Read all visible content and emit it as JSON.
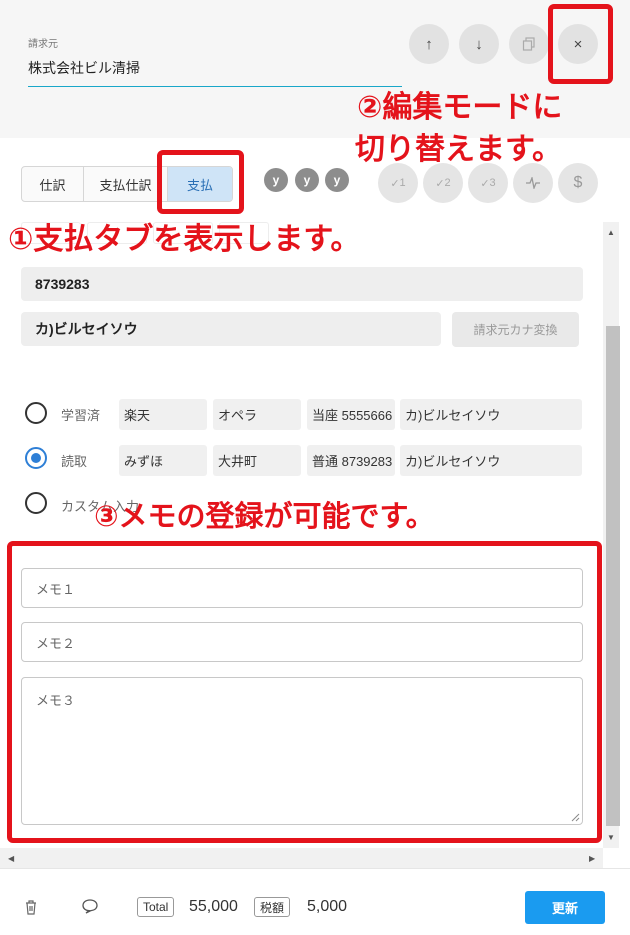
{
  "header": {
    "vendor_label": "請求元",
    "vendor_name": "株式会社ビル清掃",
    "buttons": {
      "up": "↑",
      "down": "↓",
      "close": "×"
    }
  },
  "tabs": [
    {
      "label": "仕訳"
    },
    {
      "label": "支払仕訳"
    },
    {
      "label": "支払"
    }
  ],
  "badges": [
    "y",
    "y",
    "y"
  ],
  "checks": [
    {
      "label": "1"
    },
    {
      "label": "2"
    },
    {
      "label": "3"
    }
  ],
  "dollar": "$",
  "payment": {
    "account_number": "8739283",
    "account_name_kana": "カ)ビルセイソウ",
    "kana_convert_button": "請求元カナ変換"
  },
  "radio_rows": [
    {
      "label": "学習済",
      "checked": false,
      "bank": "楽天",
      "branch": "オペラ",
      "account": "当座 5555666",
      "holder": "カ)ビルセイソウ"
    },
    {
      "label": "読取",
      "checked": true,
      "bank": "みずほ",
      "branch": "大井町",
      "account": "普通 8739283",
      "holder": "カ)ビルセイソウ"
    },
    {
      "label": "カスタム入力",
      "checked": false
    }
  ],
  "memos": {
    "memo1": "メモ１",
    "memo2": "メモ２",
    "memo3": "メモ３"
  },
  "footer": {
    "total_label": "Total",
    "total_value": "55,000",
    "tax_label": "税額",
    "tax_value": "5,000",
    "update_button": "更新"
  },
  "annotations": {
    "step1": "①支払タブを表示します。",
    "step2_line1": "②編集モードに",
    "step2_line2": "切り替えます。",
    "step3": "③メモの登録が可能です。"
  },
  "colors": {
    "annotation_red": "#e4131b",
    "primary_blue": "#1a9bf0",
    "active_tab_bg": "#cfe4f7",
    "accent_line": "#19a7c9"
  }
}
